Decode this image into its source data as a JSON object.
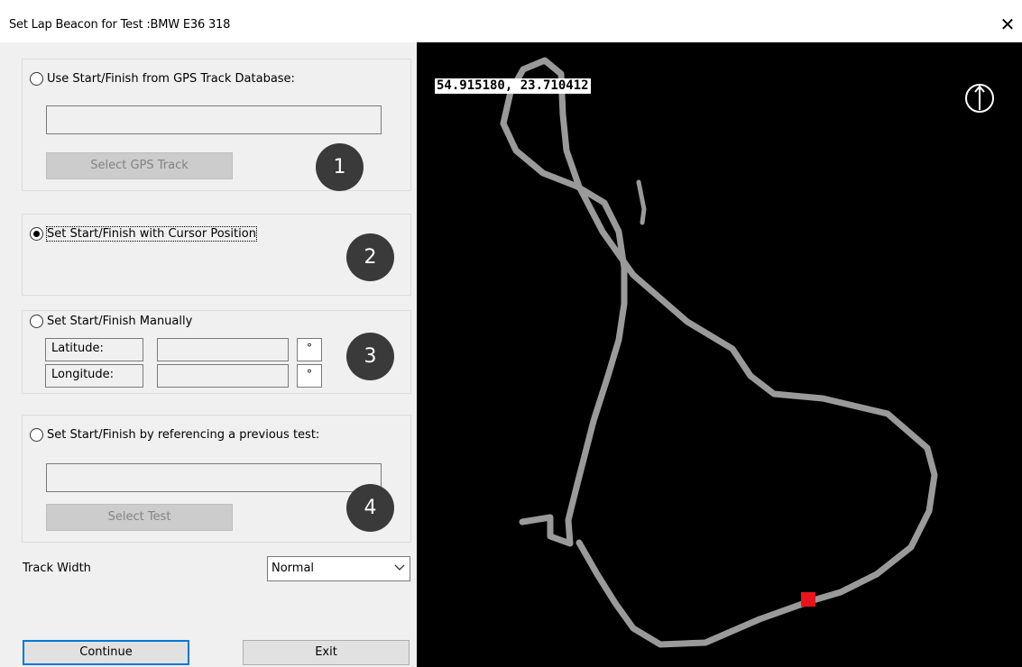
{
  "window": {
    "title": "Set Lap Beacon for Test :BMW E36 318",
    "close_label": "✕"
  },
  "options": {
    "gps_db": {
      "label": "Use Start/Finish from GPS Track Database:",
      "selected": false,
      "track_value": "",
      "button_label": "Select GPS Track",
      "badge": "1"
    },
    "cursor": {
      "label": "Set Start/Finish with Cursor Position",
      "selected": true,
      "badge": "2"
    },
    "manual": {
      "label": "Set Start/Finish Manually",
      "selected": false,
      "latitude_label": "Latitude:",
      "longitude_label": "Longitude:",
      "latitude_value": "",
      "longitude_value": "",
      "degree_symbol": "°",
      "badge": "3"
    },
    "previous": {
      "label": "Set Start/Finish by referencing a previous test:",
      "selected": false,
      "test_value": "",
      "button_label": "Select Test",
      "badge": "4"
    }
  },
  "track_width": {
    "label": "Track Width",
    "value": "Normal"
  },
  "buttons": {
    "continue": "Continue",
    "exit": "Exit"
  },
  "map": {
    "coordinates": "54.915180, 23.710412",
    "icons": {
      "north": "north-arrow-icon"
    },
    "colors": {
      "background": "#000000",
      "track": "#9a9a9a",
      "beacon": "#e8141c"
    }
  }
}
